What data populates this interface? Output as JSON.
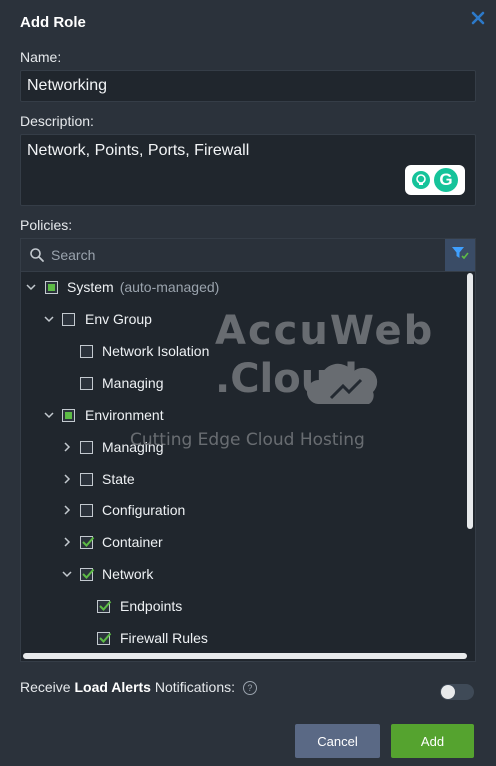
{
  "dialog": {
    "title": "Add Role",
    "close_icon": "close-icon"
  },
  "name": {
    "label": "Name:",
    "value": "Networking"
  },
  "description": {
    "label": "Description:",
    "value": "Network, Points, Ports, Firewall"
  },
  "policies": {
    "label": "Policies:",
    "search_placeholder": "Search",
    "tree": {
      "system": {
        "label": "System",
        "note": "(auto-managed)"
      },
      "env_group": {
        "label": "Env Group"
      },
      "network_isolation": {
        "label": "Network Isolation"
      },
      "managing_1": {
        "label": "Managing"
      },
      "environment": {
        "label": "Environment"
      },
      "managing_2": {
        "label": "Managing"
      },
      "state": {
        "label": "State"
      },
      "configuration": {
        "label": "Configuration"
      },
      "container": {
        "label": "Container"
      },
      "network": {
        "label": "Network"
      },
      "endpoints": {
        "label": "Endpoints"
      },
      "firewall_rules": {
        "label": "Firewall Rules"
      }
    }
  },
  "watermark": {
    "line1": "AccuWeb",
    "line2": ".Cloud",
    "tagline": "Cutting Edge Cloud Hosting"
  },
  "alerts": {
    "prefix": "Receive ",
    "bold": "Load Alerts",
    "suffix": " Notifications:",
    "toggle_on": false
  },
  "buttons": {
    "cancel": "Cancel",
    "add": "Add"
  },
  "colors": {
    "accent_green": "#55a32f",
    "cancel_blue": "#5a6985",
    "check_green": "#5dbb46",
    "filter_blue": "#3a4c66"
  }
}
